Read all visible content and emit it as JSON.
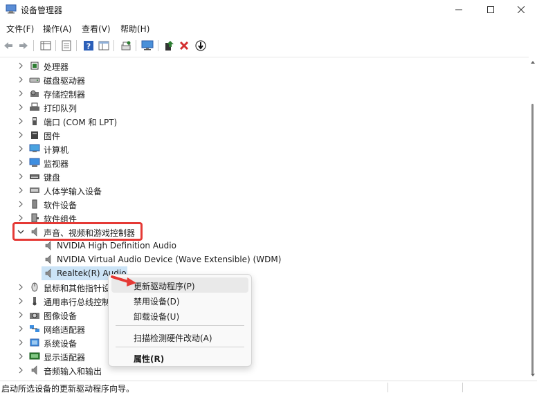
{
  "window": {
    "title": "设备管理器"
  },
  "menu": [
    "文件(F)",
    "操作(A)",
    "查看(V)",
    "帮助(H)"
  ],
  "tree": [
    {
      "label": "处理器",
      "icon": "processor-icon"
    },
    {
      "label": "磁盘驱动器",
      "icon": "disk-drive-icon"
    },
    {
      "label": "存储控制器",
      "icon": "storage-controller-icon"
    },
    {
      "label": "打印队列",
      "icon": "printer-icon"
    },
    {
      "label": "端口 (COM 和 LPT)",
      "icon": "port-icon"
    },
    {
      "label": "固件",
      "icon": "firmware-icon"
    },
    {
      "label": "计算机",
      "icon": "computer-icon"
    },
    {
      "label": "监视器",
      "icon": "monitor-icon"
    },
    {
      "label": "键盘",
      "icon": "keyboard-icon"
    },
    {
      "label": "人体学输入设备",
      "icon": "hid-icon"
    },
    {
      "label": "软件设备",
      "icon": "software-device-icon"
    },
    {
      "label": "软件组件",
      "icon": "software-component-icon"
    },
    {
      "label": "声音、视频和游戏控制器",
      "icon": "speaker-icon",
      "expanded": true
    },
    {
      "label": "NVIDIA High Definition Audio",
      "icon": "speaker-icon",
      "child": true
    },
    {
      "label": "NVIDIA Virtual Audio Device (Wave Extensible) (WDM)",
      "icon": "speaker-icon",
      "child": true
    },
    {
      "label": "Realtek(R) Audio",
      "icon": "speaker-icon",
      "child": true,
      "selected": true
    },
    {
      "label": "鼠标和其他指针设备",
      "icon": "mouse-icon"
    },
    {
      "label": "通用串行总线控制器",
      "icon": "usb-icon"
    },
    {
      "label": "图像设备",
      "icon": "camera-icon"
    },
    {
      "label": "网络适配器",
      "icon": "network-adapter-icon"
    },
    {
      "label": "系统设备",
      "icon": "system-device-icon"
    },
    {
      "label": "显示适配器",
      "icon": "display-adapter-icon"
    },
    {
      "label": "音频输入和输出",
      "icon": "speaker-icon"
    }
  ],
  "context_menu": {
    "update_driver": "更新驱动程序(P)",
    "disable_device": "禁用设备(D)",
    "uninstall_device": "卸载设备(U)",
    "scan_hardware": "扫描检测硬件改动(A)",
    "properties": "属性(R)"
  },
  "status": {
    "text": "启动所选设备的更新驱动程序向导。"
  },
  "colors": {
    "selection": "#cce4f7",
    "highlight_red": "#e53935",
    "accent_green": "#2e7d32",
    "accent_red": "#d32f2f",
    "accent_blue": "#1565c0"
  }
}
